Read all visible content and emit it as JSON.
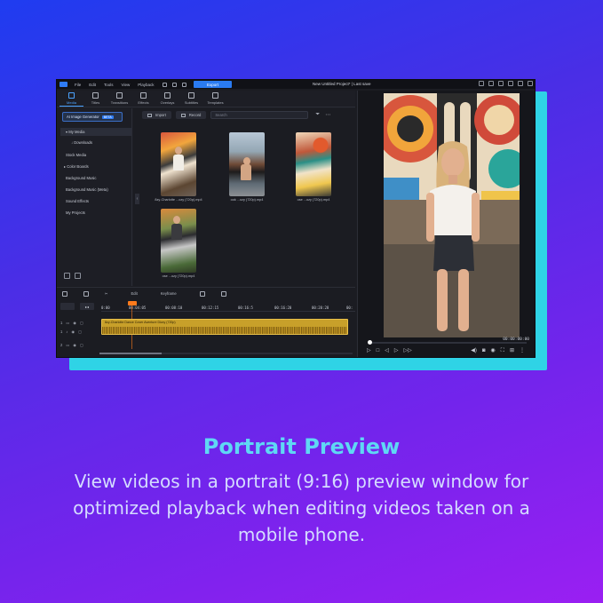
{
  "app": {
    "menu": [
      "File",
      "Edit",
      "Tools",
      "View",
      "Playback"
    ],
    "export_label": "Export",
    "project_title": "New Untitled Project* | Last save"
  },
  "tabs": [
    {
      "label": "Media",
      "icon": "media-icon",
      "active": true
    },
    {
      "label": "Titles",
      "icon": "titles-icon"
    },
    {
      "label": "Transitions",
      "icon": "transitions-icon"
    },
    {
      "label": "Effects",
      "icon": "effects-icon"
    },
    {
      "label": "Overlays",
      "icon": "overlays-icon"
    },
    {
      "label": "Subtitles",
      "icon": "subtitles-icon"
    },
    {
      "label": "Templates",
      "icon": "templates-icon"
    }
  ],
  "sidebar": {
    "ai_button": "AI Image Generator",
    "beta_badge": "BETA",
    "items": [
      "My Media",
      "Downloads",
      "Stock Media",
      "Color Boards",
      "Background Music",
      "Background Music (Meta)",
      "Sound Effects",
      "My Projects"
    ]
  },
  "library": {
    "import_label": "Import",
    "record_label": "Record",
    "search_placeholder": "Search",
    "thumbnails": [
      {
        "label": "8zy-Charlotte ...ozy (720p).mp4"
      },
      {
        "label": "ook ...ozy (720p).mp4"
      },
      {
        "label": "ose ...ozy (720p).mp4"
      },
      {
        "label": "ose ...ozy (720p).mp4"
      }
    ]
  },
  "timeline": {
    "edit_label": "Edit",
    "keyframe_label": "Keyframe",
    "ruler": [
      "0:00",
      "00:04:05",
      "00:08:10",
      "00:12:15",
      "00:16:5",
      "00:16:20",
      "00:20:28",
      "00:24:20",
      "00:"
    ],
    "clip_title": "8zy-Charlotte Dance Cover Aventure Dizzy (720p)"
  },
  "preview": {
    "timecode": "00:00:00:00",
    "progress": 0.0
  },
  "caption": {
    "title": "Portrait Preview",
    "body": "View videos in a portrait (9:16) preview window for optimized playback when editing videos taken on a mobile phone."
  },
  "colors": {
    "accent": "#2f7cf6",
    "caption_title": "#5fd8f4",
    "cyan_backdrop": "#2fd3e6",
    "playhead": "#ff7b1c",
    "clip": "#c8a02a"
  }
}
